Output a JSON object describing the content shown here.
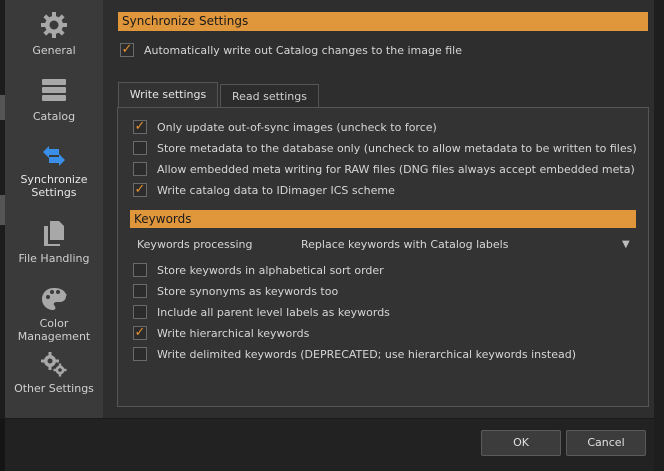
{
  "sidebar": {
    "items": [
      {
        "label": "General",
        "icon": "gear-icon"
      },
      {
        "label": "Catalog",
        "icon": "database-icon"
      },
      {
        "label": "Synchronize\nSettings",
        "icon": "sync-arrows-icon"
      },
      {
        "label": "File Handling",
        "icon": "files-icon"
      },
      {
        "label": "Color\nManagement",
        "icon": "palette-icon"
      },
      {
        "label": "Other Settings",
        "icon": "gears-icon"
      }
    ],
    "active_index": 2
  },
  "main": {
    "section_title": "Synchronize Settings",
    "auto_write": {
      "label": "Automatically write out Catalog changes to the image file",
      "checked": true
    },
    "tabs": [
      {
        "label": "Write settings",
        "active": true
      },
      {
        "label": "Read settings",
        "active": false
      }
    ],
    "write_options": [
      {
        "label": "Only update out-of-sync images (uncheck to force)",
        "checked": true
      },
      {
        "label": "Store metadata to the database only (uncheck to allow metadata to be written to files)",
        "checked": false
      },
      {
        "label": "Allow embedded meta writing for RAW files (DNG files always accept embedded meta)",
        "checked": false
      },
      {
        "label": "Write catalog data to IDimager ICS scheme",
        "checked": true
      }
    ],
    "keywords": {
      "title": "Keywords",
      "processing_label": "Keywords processing",
      "processing_value": "Replace keywords with Catalog labels",
      "options": [
        {
          "label": "Store keywords in alphabetical sort order",
          "checked": false
        },
        {
          "label": "Store synonyms as keywords too",
          "checked": false
        },
        {
          "label": "Include all parent level labels as keywords",
          "checked": false
        },
        {
          "label": "Write hierarchical keywords",
          "checked": true
        },
        {
          "label": "Write delimited keywords (DEPRECATED; use hierarchical keywords instead)",
          "checked": false
        }
      ]
    }
  },
  "footer": {
    "ok_label": "OK",
    "cancel_label": "Cancel"
  },
  "colors": {
    "accent": "#e0963a",
    "check": "#e8922e",
    "sync_icon": "#3a8fe8"
  }
}
